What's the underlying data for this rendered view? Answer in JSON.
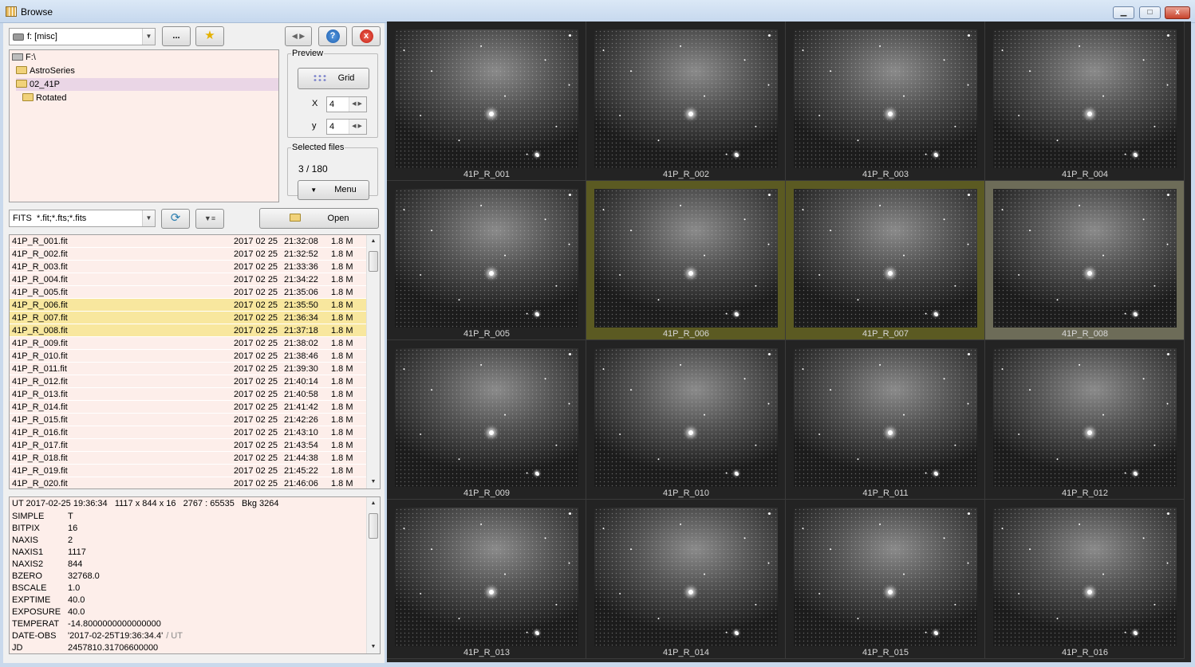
{
  "window": {
    "title": "Browse",
    "min_label": "▁",
    "max_label": "□",
    "close_label": "x"
  },
  "toolbar": {
    "drive_value": "f: [misc]",
    "browse_label": "...",
    "fav_icon": "★",
    "nav_icon": "◀ ▶",
    "help_icon": "?",
    "close_icon": "x"
  },
  "tree": [
    {
      "label": "F:\\",
      "icon": "drive-icon"
    },
    {
      "label": "AstroSeries",
      "icon": "folder-icon"
    },
    {
      "label": "02_41P",
      "icon": "folder-icon"
    },
    {
      "label": "Rotated",
      "icon": "folder-icon"
    }
  ],
  "preview": {
    "legend": "Preview",
    "grid_label": "Grid",
    "x_label": "X",
    "x_value": "4",
    "y_label": "y",
    "y_value": "4"
  },
  "selected": {
    "legend": "Selected files",
    "count": "3 / 180",
    "menu_label": "Menu"
  },
  "filter": {
    "value": "FITS  *.fit;*.fts;*.fits",
    "open_label": "Open"
  },
  "files": [
    {
      "name": "41P_R_001.fit",
      "date": "2017 02 25",
      "time": "21:32:08",
      "size": "1.8 M"
    },
    {
      "name": "41P_R_002.fit",
      "date": "2017 02 25",
      "time": "21:32:52",
      "size": "1.8 M"
    },
    {
      "name": "41P_R_003.fit",
      "date": "2017 02 25",
      "time": "21:33:36",
      "size": "1.8 M"
    },
    {
      "name": "41P_R_004.fit",
      "date": "2017 02 25",
      "time": "21:34:22",
      "size": "1.8 M"
    },
    {
      "name": "41P_R_005.fit",
      "date": "2017 02 25",
      "time": "21:35:06",
      "size": "1.8 M"
    },
    {
      "name": "41P_R_006.fit",
      "date": "2017 02 25",
      "time": "21:35:50",
      "size": "1.8 M",
      "selected": true
    },
    {
      "name": "41P_R_007.fit",
      "date": "2017 02 25",
      "time": "21:36:34",
      "size": "1.8 M",
      "selected": true
    },
    {
      "name": "41P_R_008.fit",
      "date": "2017 02 25",
      "time": "21:37:18",
      "size": "1.8 M",
      "selected": true
    },
    {
      "name": "41P_R_009.fit",
      "date": "2017 02 25",
      "time": "21:38:02",
      "size": "1.8 M"
    },
    {
      "name": "41P_R_010.fit",
      "date": "2017 02 25",
      "time": "21:38:46",
      "size": "1.8 M"
    },
    {
      "name": "41P_R_011.fit",
      "date": "2017 02 25",
      "time": "21:39:30",
      "size": "1.8 M"
    },
    {
      "name": "41P_R_012.fit",
      "date": "2017 02 25",
      "time": "21:40:14",
      "size": "1.8 M"
    },
    {
      "name": "41P_R_013.fit",
      "date": "2017 02 25",
      "time": "21:40:58",
      "size": "1.8 M"
    },
    {
      "name": "41P_R_014.fit",
      "date": "2017 02 25",
      "time": "21:41:42",
      "size": "1.8 M"
    },
    {
      "name": "41P_R_015.fit",
      "date": "2017 02 25",
      "time": "21:42:26",
      "size": "1.8 M"
    },
    {
      "name": "41P_R_016.fit",
      "date": "2017 02 25",
      "time": "21:43:10",
      "size": "1.8 M"
    },
    {
      "name": "41P_R_017.fit",
      "date": "2017 02 25",
      "time": "21:43:54",
      "size": "1.8 M"
    },
    {
      "name": "41P_R_018.fit",
      "date": "2017 02 25",
      "time": "21:44:38",
      "size": "1.8 M"
    },
    {
      "name": "41P_R_019.fit",
      "date": "2017 02 25",
      "time": "21:45:22",
      "size": "1.8 M"
    },
    {
      "name": "41P_R_020.fit",
      "date": "2017 02 25",
      "time": "21:46:06",
      "size": "1.8 M"
    }
  ],
  "header": {
    "summary": "UT 2017-02-25 19:36:34   1117 x 844 x 16   2767 : 65535   Bkg 3264",
    "rows": [
      {
        "key": "SIMPLE",
        "value": "T"
      },
      {
        "key": "BITPIX",
        "value": "16"
      },
      {
        "key": "NAXIS",
        "value": "2"
      },
      {
        "key": "NAXIS1",
        "value": "1117"
      },
      {
        "key": "NAXIS2",
        "value": "844"
      },
      {
        "key": "BZERO",
        "value": "32768.0"
      },
      {
        "key": "BSCALE",
        "value": "1.0"
      },
      {
        "key": "EXPTIME",
        "value": "40.0"
      },
      {
        "key": "EXPOSURE",
        "value": "40.0"
      },
      {
        "key": "TEMPERAT",
        "value": "-14.8000000000000000"
      },
      {
        "key": "DATE-OBS",
        "value": "'2017-02-25T19:36:34.4'",
        "comment": "/ UT"
      },
      {
        "key": "JD",
        "value": "2457810.31706600000"
      }
    ]
  },
  "thumbnails": [
    {
      "label": "41P_R_001"
    },
    {
      "label": "41P_R_002"
    },
    {
      "label": "41P_R_003"
    },
    {
      "label": "41P_R_004"
    },
    {
      "label": "41P_R_005"
    },
    {
      "label": "41P_R_006",
      "sel": "sel1"
    },
    {
      "label": "41P_R_007",
      "sel": "sel2"
    },
    {
      "label": "41P_R_008",
      "sel": "sel3"
    },
    {
      "label": "41P_R_009"
    },
    {
      "label": "41P_R_010"
    },
    {
      "label": "41P_R_011"
    },
    {
      "label": "41P_R_012"
    },
    {
      "label": "41P_R_013"
    },
    {
      "label": "41P_R_014"
    },
    {
      "label": "41P_R_015"
    },
    {
      "label": "41P_R_016"
    }
  ]
}
